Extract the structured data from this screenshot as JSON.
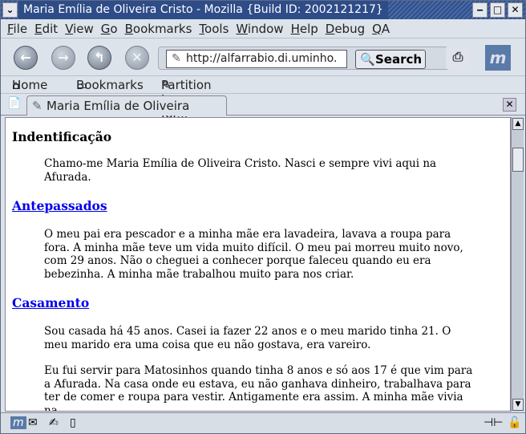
{
  "window": {
    "title": "Maria Emília de Oliveira Cristo - Mozilla {Build ID: 2002121217}"
  },
  "menu": [
    "File",
    "Edit",
    "View",
    "Go",
    "Bookmarks",
    "Tools",
    "Window",
    "Help",
    "Debug",
    "QA"
  ],
  "nav": {
    "url": "http://alfarrabio.di.uminho.",
    "search_label": "Search"
  },
  "personal": {
    "home": "Home",
    "bookmarks": "Bookmarks",
    "link": "Partition Image for..."
  },
  "tab": {
    "label": "Maria Emília de Oliveira Cristo"
  },
  "content": {
    "h1": "Indentificação",
    "p1": "Chamo-me Maria Emília de Oliveira Cristo. Nasci e sempre vivi aqui na Afurada.",
    "h2": "Antepassados",
    "p2": "O meu pai era pescador e a minha mãe era lavadeira, lavava a roupa para fora. A minha mãe teve um vida muito difícil. O meu pai morreu muito novo, com 29 anos. Não o cheguei a conhecer porque faleceu quando eu era bebezinha. A minha mãe trabalhou muito para nos criar.",
    "h3": "Casamento",
    "p3": "Sou casada há 45 anos. Casei ia fazer 22 anos e o meu marido tinha 21. O meu marido era uma coisa que eu não gostava, era vareiro.",
    "p4": "Eu fui servir para Matosinhos quando tinha 8 anos e só aos 17 é que vim para a Afurada. Na casa onde eu estava, eu não ganhava dinheiro, trabalhava para ter de comer e roupa para vestir. Antigamente era assim. A minha mãe vivia na"
  }
}
